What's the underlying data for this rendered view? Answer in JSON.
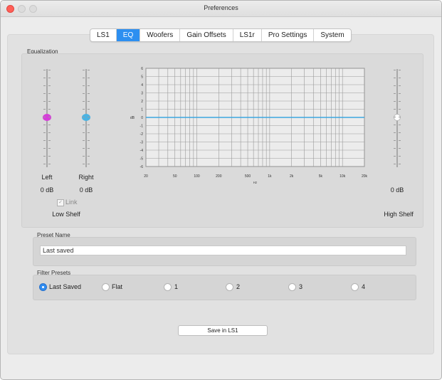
{
  "window": {
    "title": "Preferences"
  },
  "tabs": [
    {
      "label": "LS1",
      "active": false
    },
    {
      "label": "EQ",
      "active": true
    },
    {
      "label": "Woofers",
      "active": false
    },
    {
      "label": "Gain Offsets",
      "active": false
    },
    {
      "label": "LS1r",
      "active": false
    },
    {
      "label": "Pro Settings",
      "active": false
    },
    {
      "label": "System",
      "active": false
    }
  ],
  "equalization": {
    "group_label": "Equalization",
    "low_shelf": {
      "label": "Low Shelf",
      "left": {
        "label": "Left",
        "value": "0 dB",
        "color": "#d63ed9"
      },
      "right": {
        "label": "Right",
        "value": "0 dB",
        "color": "#4ab3e3"
      },
      "link_label": "Link",
      "link_checked": true
    },
    "high_shelf": {
      "label": "High Shelf",
      "value": "0 dB"
    }
  },
  "chart_data": {
    "type": "line",
    "ylabel": "dB",
    "xlabel": "Hz",
    "y_ticks": [
      "6",
      "5",
      "4",
      "3",
      "2",
      "1",
      "0",
      "-1",
      "-2",
      "-3",
      "-4",
      "-5",
      "-6"
    ],
    "x_ticks": [
      "20",
      "50",
      "100",
      "200",
      "500",
      "1k",
      "2k",
      "5k",
      "10k",
      "20k"
    ],
    "x_tick_values": [
      20,
      50,
      100,
      200,
      500,
      1000,
      2000,
      5000,
      10000,
      20000
    ],
    "ylim": [
      -6,
      6
    ],
    "xlim": [
      20,
      20000
    ],
    "x_scale": "log",
    "grid": true,
    "series": [
      {
        "color": "#3da6e0",
        "x": [
          20,
          20000
        ],
        "y": [
          0,
          0
        ]
      }
    ]
  },
  "preset_name": {
    "group_label": "Preset Name",
    "value": "Last saved"
  },
  "filter_presets": {
    "group_label": "Filter Presets",
    "options": [
      {
        "label": "Last Saved",
        "selected": true
      },
      {
        "label": "Flat",
        "selected": false
      },
      {
        "label": "1",
        "selected": false
      },
      {
        "label": "2",
        "selected": false
      },
      {
        "label": "3",
        "selected": false
      },
      {
        "label": "4",
        "selected": false
      }
    ]
  },
  "save_button": {
    "label": "Save in LS1"
  }
}
